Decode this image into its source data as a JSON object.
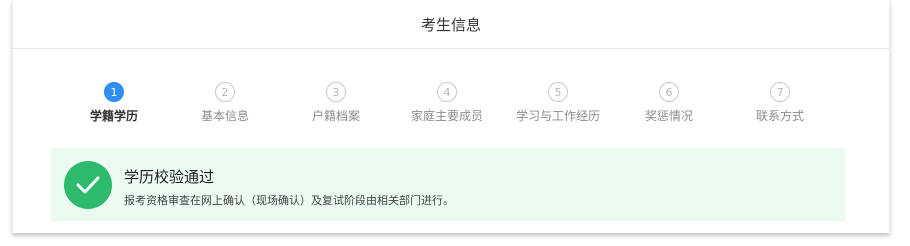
{
  "header": {
    "title": "考生信息"
  },
  "steps": [
    {
      "number": "1",
      "label": "学籍学历",
      "active": true
    },
    {
      "number": "2",
      "label": "基本信息",
      "active": false
    },
    {
      "number": "3",
      "label": "户籍档案",
      "active": false
    },
    {
      "number": "4",
      "label": "家庭主要成员",
      "active": false
    },
    {
      "number": "5",
      "label": "学习与工作经历",
      "active": false
    },
    {
      "number": "6",
      "label": "奖惩情况",
      "active": false
    },
    {
      "number": "7",
      "label": "联系方式",
      "active": false
    }
  ],
  "alert": {
    "icon": "check-circle-icon",
    "title": "学历校验通过",
    "description": "报考资格审查在网上确认（现场确认）及复试阶段由相关部门进行。"
  },
  "colors": {
    "active_step": "#2f8ef0",
    "success": "#2dba6c",
    "success_bg": "#ebfbf1"
  }
}
